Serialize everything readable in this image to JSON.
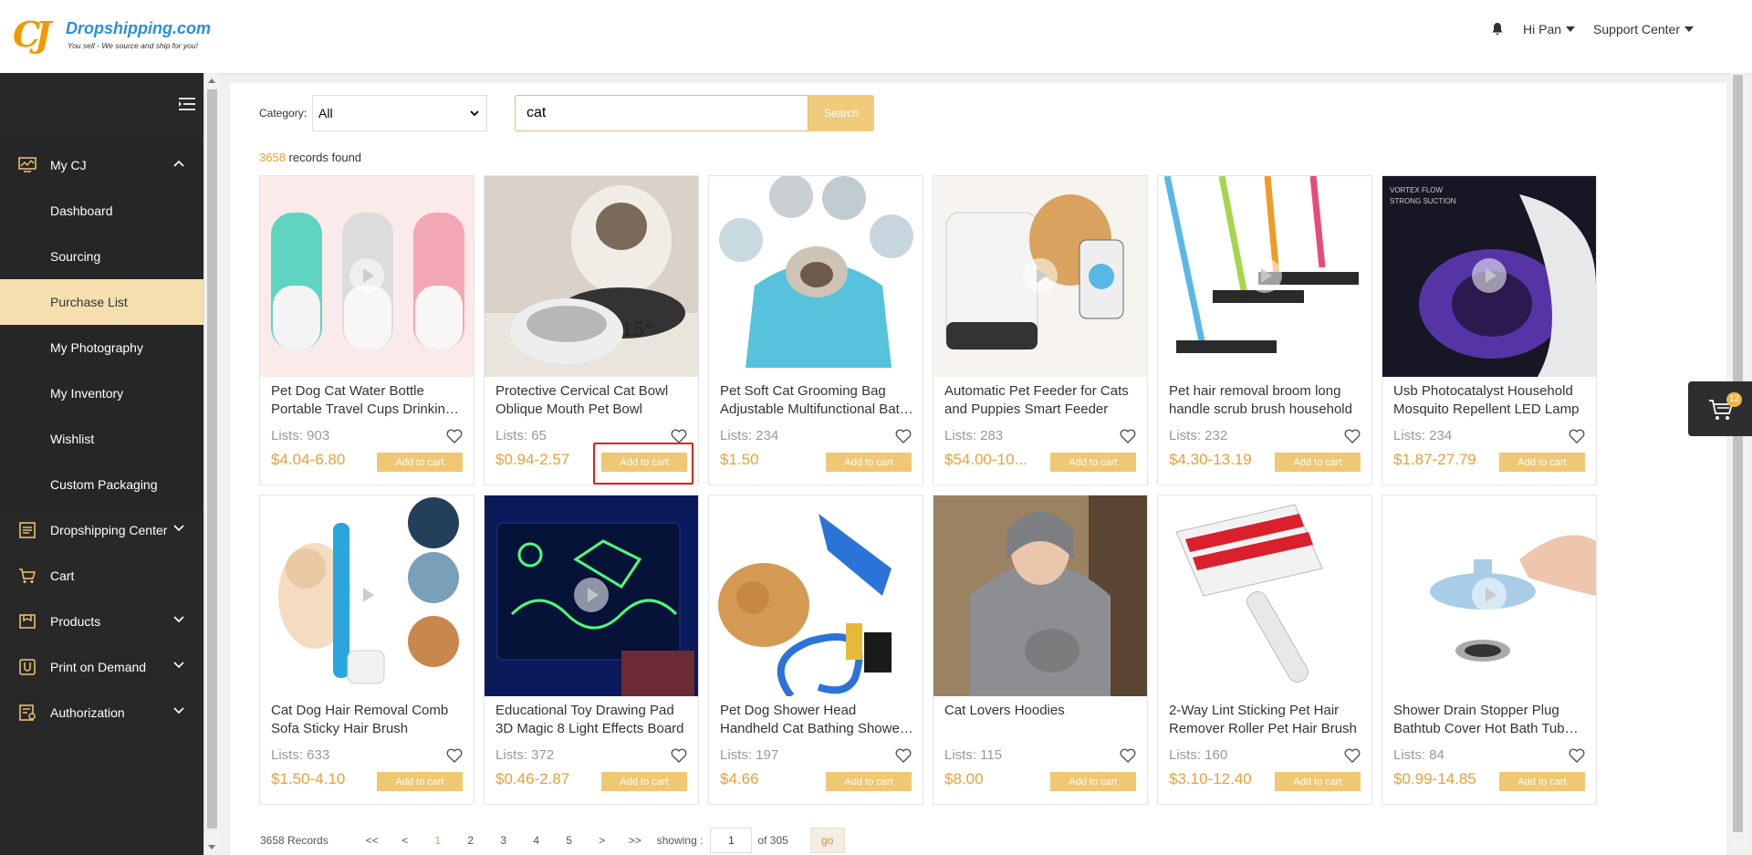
{
  "header": {
    "logo_text": "Dropshipping.com",
    "logo_tagline": "You sell - We source and ship for you!",
    "greeting": "Hi Pan",
    "support": "Support Center"
  },
  "sidebar": {
    "sections": [
      {
        "label": "My CJ",
        "icon": "monitor-chart-icon",
        "expanded": true,
        "children": [
          "Dashboard",
          "Sourcing",
          "Purchase List",
          "My Photography",
          "My Inventory",
          "Wishlist",
          "Custom Packaging"
        ],
        "active_child": "Purchase List"
      },
      {
        "label": "Dropshipping Center",
        "icon": "document-list-icon"
      },
      {
        "label": "Cart",
        "icon": "cart-icon"
      },
      {
        "label": "Products",
        "icon": "box-icon"
      },
      {
        "label": "Print on Demand",
        "icon": "print-icon"
      },
      {
        "label": "Authorization",
        "icon": "authorization-icon"
      }
    ]
  },
  "filters": {
    "category_label": "Category:",
    "category_value": "All",
    "search_value": "cat",
    "search_button": "Search"
  },
  "results": {
    "count": "3658",
    "suffix": "records found"
  },
  "products": [
    {
      "title": "Pet Dog Cat Water Bottle Portable Travel Cups Drinking Bowl",
      "lists": "Lists: 903",
      "price": "$4.04-6.80",
      "cta": "Add to cart",
      "image": "water-bottles"
    },
    {
      "title": "Protective Cervical Cat Bowl Oblique Mouth Pet Bowl",
      "lists": "Lists: 65",
      "price": "$0.94-2.57",
      "cta": "Add to cart",
      "image": "cat-bowl"
    },
    {
      "title": "Pet Soft Cat Grooming Bag Adjustable Multifunctional Bath Bag",
      "lists": "Lists: 234",
      "price": "$1.50",
      "cta": "Add to cart",
      "image": "grooming-bag"
    },
    {
      "title": "Automatic Pet Feeder for Cats and Puppies Smart Feeder",
      "lists": "Lists: 283",
      "price": "$54.00-10...",
      "cta": "Add to cart",
      "image": "pet-feeder"
    },
    {
      "title": "Pet hair removal broom long handle scrub brush household",
      "lists": "Lists: 232",
      "price": "$4.30-13.19",
      "cta": "Add to cart",
      "image": "broom"
    },
    {
      "title": "Usb Photocatalyst Household Mosquito Repellent LED Lamp",
      "lists": "Lists: 234",
      "price": "$1.87-27.79",
      "cta": "Add to cart",
      "image": "mosquito-lamp"
    },
    {
      "title": "Cat Dog Hair Removal Comb Sofa Sticky Hair Brush",
      "lists": "Lists: 633",
      "price": "$1.50-4.10",
      "cta": "Add to cart",
      "image": "hair-comb"
    },
    {
      "title": "Educational Toy Drawing Pad 3D Magic 8 Light Effects Board",
      "lists": "Lists: 372",
      "price": "$0.46-2.87",
      "cta": "Add to cart",
      "image": "drawing-pad"
    },
    {
      "title": "Pet Dog Shower Head Handheld Cat Bathing Shower Tool",
      "lists": "Lists: 197",
      "price": "$4.66",
      "cta": "Add to cart",
      "image": "shower-head"
    },
    {
      "title": "Cat Lovers Hoodies",
      "lists": "Lists: 115",
      "price": "$8.00",
      "cta": "Add to cart",
      "image": "hoodie"
    },
    {
      "title": "2-Way Lint Sticking Pet Hair Remover Roller Pet Hair Brush",
      "lists": "Lists: 160",
      "price": "$3.10-12.40",
      "cta": "Add to cart",
      "image": "lint-roller"
    },
    {
      "title": "Shower Drain Stopper Plug Bathtub Cover Hot Bath Tub Plug",
      "lists": "Lists: 84",
      "price": "$0.99-14.85",
      "cta": "Add to cart",
      "image": "drain-stopper"
    }
  ],
  "pagination": {
    "records": "3658 Records",
    "first": "<<",
    "prev": "<",
    "pages": [
      "1",
      "2",
      "3",
      "4",
      "5"
    ],
    "next": ">",
    "last": ">>",
    "showing": "showing :",
    "current": "1",
    "of": "of 305",
    "go": "go"
  },
  "float_cart": {
    "badge": "12"
  },
  "colors": {
    "accent": "#f0c773",
    "price": "#e8a03a",
    "sidebar": "#282828",
    "active": "#f5dfae",
    "highlight": "#e02020"
  }
}
